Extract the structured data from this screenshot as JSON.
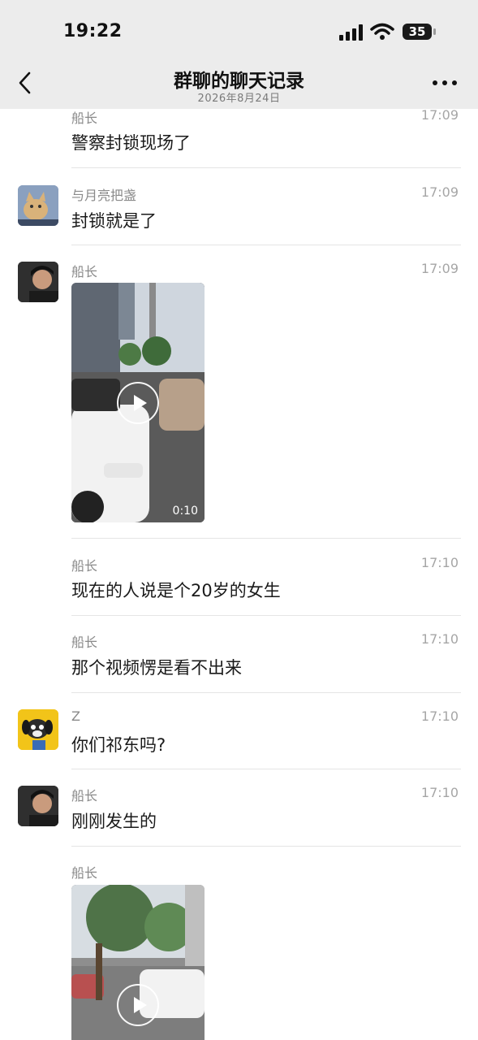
{
  "status_bar": {
    "time": "19:22",
    "battery": "35"
  },
  "nav": {
    "title": "群聊的聊天记录",
    "subtitle": "2026年8月24日",
    "back_icon": "chevron-left-icon",
    "more_icon": "more-dots-icon"
  },
  "messages": [
    {
      "sender": "船长",
      "time": "17:09",
      "text": "警察封锁现场了"
    },
    {
      "sender": "与月亮把盏",
      "time": "17:09",
      "text": "封锁就是了"
    },
    {
      "sender": "船长",
      "time": "17:09",
      "video_duration": "0:10"
    },
    {
      "sender": "船长",
      "time": "17:10",
      "text": "现在的人说是个20岁的女生"
    },
    {
      "sender": "船长",
      "time": "17:10",
      "text": "那个视频愣是看不出来"
    },
    {
      "sender": "Z",
      "time": "17:10",
      "text": "你们祁东吗?"
    },
    {
      "sender": "船长",
      "time": "17:10",
      "text": "刚刚发生的"
    },
    {
      "sender": "船长"
    }
  ],
  "colors": {
    "header_bg": "#ececec",
    "divider": "#e5e5e5",
    "sender_text": "#8a8a8a",
    "time_text": "#a6a6a6"
  }
}
